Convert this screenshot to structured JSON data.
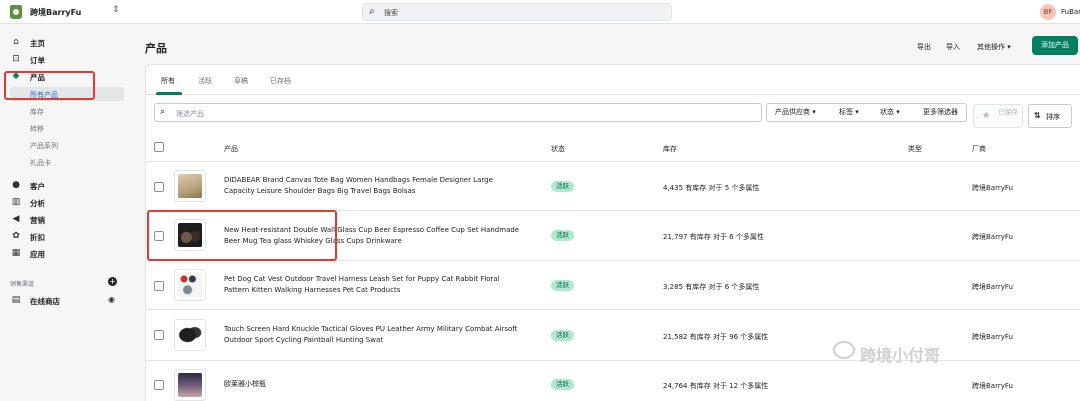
{
  "topbar": {
    "store_name": "跨境BarryFu",
    "switch_icon": "⇕",
    "search_placeholder": "搜索",
    "avatar_initials": "BF",
    "user_name": "FuBarry"
  },
  "sidebar": {
    "items": [
      {
        "label": "主页",
        "icon": "⌂"
      },
      {
        "label": "订单",
        "icon": "⊡"
      },
      {
        "label": "产品",
        "icon": "◆"
      },
      {
        "label": "客户",
        "icon": "●"
      },
      {
        "label": "分析",
        "icon": "▥"
      },
      {
        "label": "营销",
        "icon": "◀"
      },
      {
        "label": "折扣",
        "icon": "✿"
      },
      {
        "label": "应用",
        "icon": "▦"
      }
    ],
    "sub_items": [
      "所有产品",
      "库存",
      "转移",
      "产品系列",
      "礼品卡"
    ],
    "channels_label": "销售渠道",
    "channel_online": "在线商店"
  },
  "page": {
    "title": "产品",
    "export": "导出",
    "import": "导入",
    "more_actions": "其他操作 ▾",
    "add_product": "添加产品"
  },
  "tabs": [
    "所有",
    "活跃",
    "草稿",
    "已存档"
  ],
  "filters": {
    "placeholder": "筛选产品",
    "vendor": "产品供应商 ▾",
    "tags": "标签 ▾",
    "status": "状态 ▾",
    "more": "更多筛选器",
    "saved": "已保存",
    "sort": "排序"
  },
  "columns": {
    "product": "产品",
    "status": "状态",
    "inventory": "库存",
    "type": "类型",
    "vendor": "厂商"
  },
  "rows": [
    {
      "name": "DIDABEAR Brand Canvas Tote Bag Women Handbags Female Designer Large Capacity Leisure Shoulder Bags Big Travel Bags Bolsas",
      "status": "活跃",
      "inventory": "4,435 有库存 对于 5 个多属性",
      "vendor": "跨境BarryFu"
    },
    {
      "name": "New Heat-resistant Double Wall Glass Cup Beer Espresso Coffee Cup Set Handmade Beer Mug Tea glass Whiskey Glass Cups Drinkware",
      "status": "活跃",
      "inventory": "21,797 有库存 对于 6 个多属性",
      "vendor": "跨境BarryFu"
    },
    {
      "name": "Pet Dog Cat Vest Outdoor Travel Harness Leash Set for Puppy Cat Rabbit Floral Pattern Kitten Walking Harnesses Pet Cat Products",
      "status": "活跃",
      "inventory": "3,285 有库存 对于 6 个多属性",
      "vendor": "跨境BarryFu"
    },
    {
      "name": "Touch Screen Hard Knuckle Tactical Gloves PU Leather Army Military Combat Airsoft Outdoor Sport Cycling Paintball Hunting Swat",
      "status": "活跃",
      "inventory": "21,582 有库存 对于 96 个多属性",
      "vendor": "跨境BarryFu"
    },
    {
      "name": "欧莱雅小棕瓶",
      "status": "活跃",
      "inventory": "24,764 有库存 对于 12 个多属性",
      "vendor": "跨境BarryFu"
    }
  ],
  "watermark": "跨境小付哥",
  "colors": {
    "accent": "#008060",
    "status_bg": "#aee9d1",
    "highlight": "#e53935",
    "link": "#2c6ecb"
  }
}
